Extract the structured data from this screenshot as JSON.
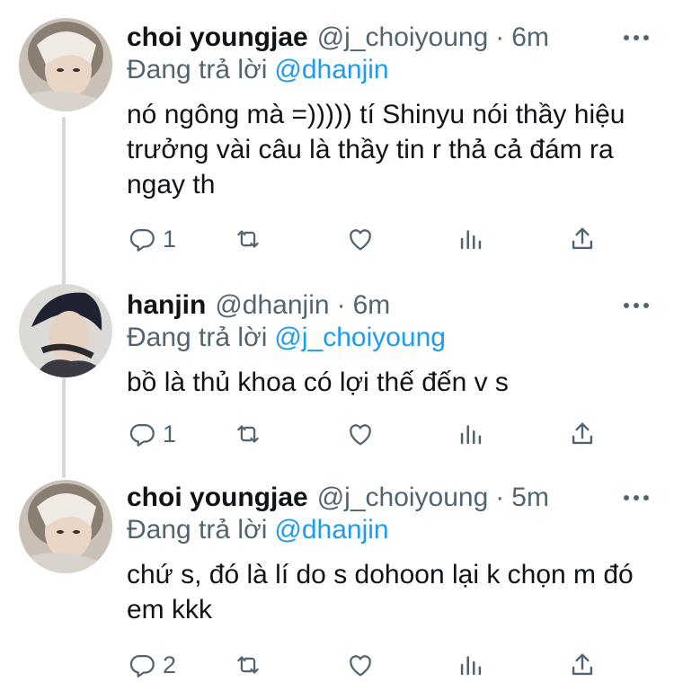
{
  "tweets": [
    {
      "name": "choi youngjae",
      "handle": "@j_choiyoung",
      "separator": "·",
      "time": "6m",
      "reply_prefix": "Đang trả lời",
      "reply_to": "@dhanjin",
      "text": "nó ngông mà =))))) tí Shinyu nói thầy hiệu trưởng vài câu là thầy tin r thả cả đám ra ngay th",
      "reply_count": "1"
    },
    {
      "name": "hanjin",
      "handle": "@dhanjin",
      "separator": "·",
      "time": "6m",
      "reply_prefix": "Đang trả lời",
      "reply_to": "@j_choiyoung",
      "text": "bồ là thủ khoa có lợi thế đến v s",
      "reply_count": "1"
    },
    {
      "name": "choi youngjae",
      "handle": "@j_choiyoung",
      "separator": "·",
      "time": "5m",
      "reply_prefix": "Đang trả lời",
      "reply_to": "@dhanjin",
      "text": "chứ s, đó là lí do s dohoon lại k chọn m đó em kkk",
      "reply_count": "2"
    }
  ],
  "icons": {
    "reply": "reply-icon",
    "retweet": "retweet-icon",
    "like": "like-icon",
    "analytics": "analytics-icon",
    "share": "share-icon",
    "more": "more-options-icon"
  },
  "colors": {
    "link": "#1d9bf0",
    "secondary_text": "#536471",
    "thread_line": "#cfd9de"
  }
}
